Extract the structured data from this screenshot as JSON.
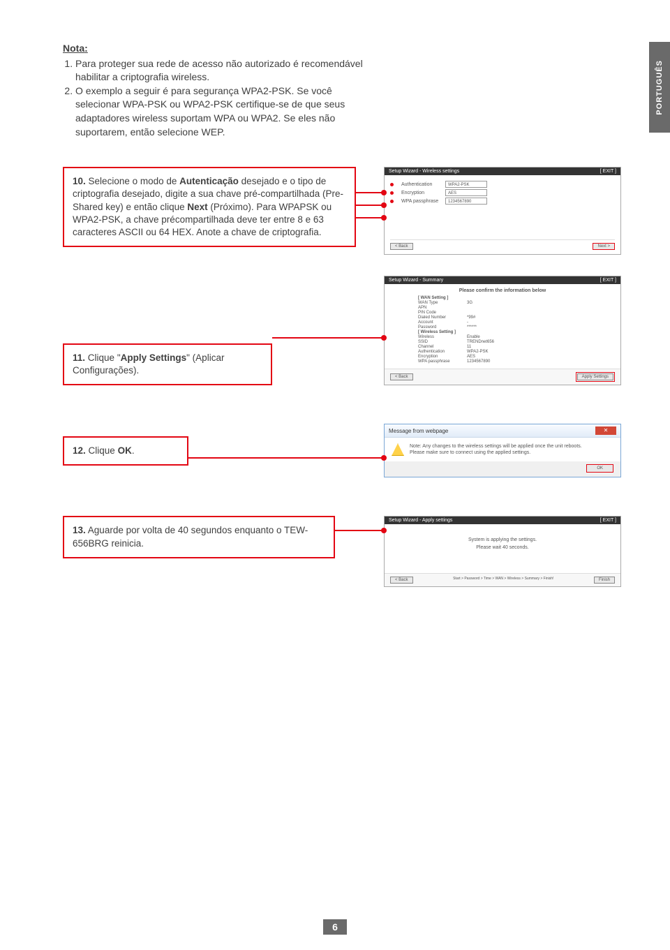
{
  "sideTab": "PORTUGUÊS",
  "nota": {
    "label": "Nota",
    "item1": "Para proteger sua rede de acesso não autorizado é recomendável habilitar a criptografia wireless.",
    "item2_a": "O exemplo a seguir é para segurança WPA2-PSK. Se você selecionar WPA-PSK ou WPA2-PSK certifique-se de que seus adaptadores wireless suportam WPA ou WPA2. Se eles não suportarem, então selecione WEP."
  },
  "step10": {
    "num": "10.",
    "text_a": "Selecione o modo de ",
    "text_b": "Autenticação",
    "text_c": " desejado e o tipo de criptografia desejado, digite a sua chave pré-compartilhada (Pre-Shared key) e então clique ",
    "text_d": "Next",
    "text_e": " (Próximo). Para WPAPSK ou WPA2-PSK, a chave précompartilhada deve ter entre 8 e 63 caracteres ASCII ou 64 HEX. Anote a chave de criptografia."
  },
  "ss10": {
    "header": "Setup Wizard - Wireless settings",
    "exit": "[ EXIT ]",
    "row1_lbl": "Authentication",
    "row1_val": "WPA2-PSK",
    "row2_lbl": "Encryption",
    "row2_val": "AES",
    "row3_lbl": "WPA passphrase",
    "row3_val": "1234567890",
    "back": "< Back",
    "next": "Next >"
  },
  "ss11": {
    "header": "Setup Wizard - Summary",
    "exit": "[ EXIT ]",
    "confirm": "Please confirm the information below",
    "sec1": "[ WAN Setting ]",
    "k1": "WAN Type",
    "v1": "3G",
    "k2": "APN",
    "v2": "",
    "k3": "PIN Code",
    "v3": "",
    "k4": "Dialed Number",
    "v4": "*99#",
    "k5": "Account",
    "v5": "-",
    "k6": "Password",
    "v6": "******",
    "sec2": "[ Wireless Setting ]",
    "k7": "Wireless",
    "v7": "Enable",
    "k8": "SSID",
    "v8": "TRENDnet656",
    "k9": "Channel",
    "v9": "11",
    "k10": "Authentication",
    "v10": "WPA2-PSK",
    "k11": "Encryption",
    "v11": "AES",
    "k12": "WPA passphrase",
    "v12": "1234567890",
    "back": "< Back",
    "apply": "Apply Settings"
  },
  "step11": {
    "num": "11.",
    "text_a": "Clique \"",
    "text_b": "Apply Settings",
    "text_c": "\" (Aplicar Configurações)."
  },
  "step12": {
    "num": "12.",
    "text_a": "Clique ",
    "text_b": "OK",
    "text_c": "."
  },
  "ss12": {
    "title": "Message from webpage",
    "body1": "Note: Any changes to the wireless settings will be applied once the unit reboots.",
    "body2": "Please make sure to connect using the applied settings.",
    "ok": "OK"
  },
  "step13": {
    "num": "13.",
    "text": "Aguarde por volta de 40 segundos enquanto o TEW-656BRG reinicia."
  },
  "ss13": {
    "header": "Setup Wizard - Apply settings",
    "exit": "[ EXIT ]",
    "line1": "System is applying the settings.",
    "line2": "Please wait 40 seconds.",
    "nav1": "< Back",
    "nav2": "Start > Password > Time > WAN > Wireless > Summary > Finish!",
    "nav3": "Finish"
  },
  "pageNum": "6"
}
